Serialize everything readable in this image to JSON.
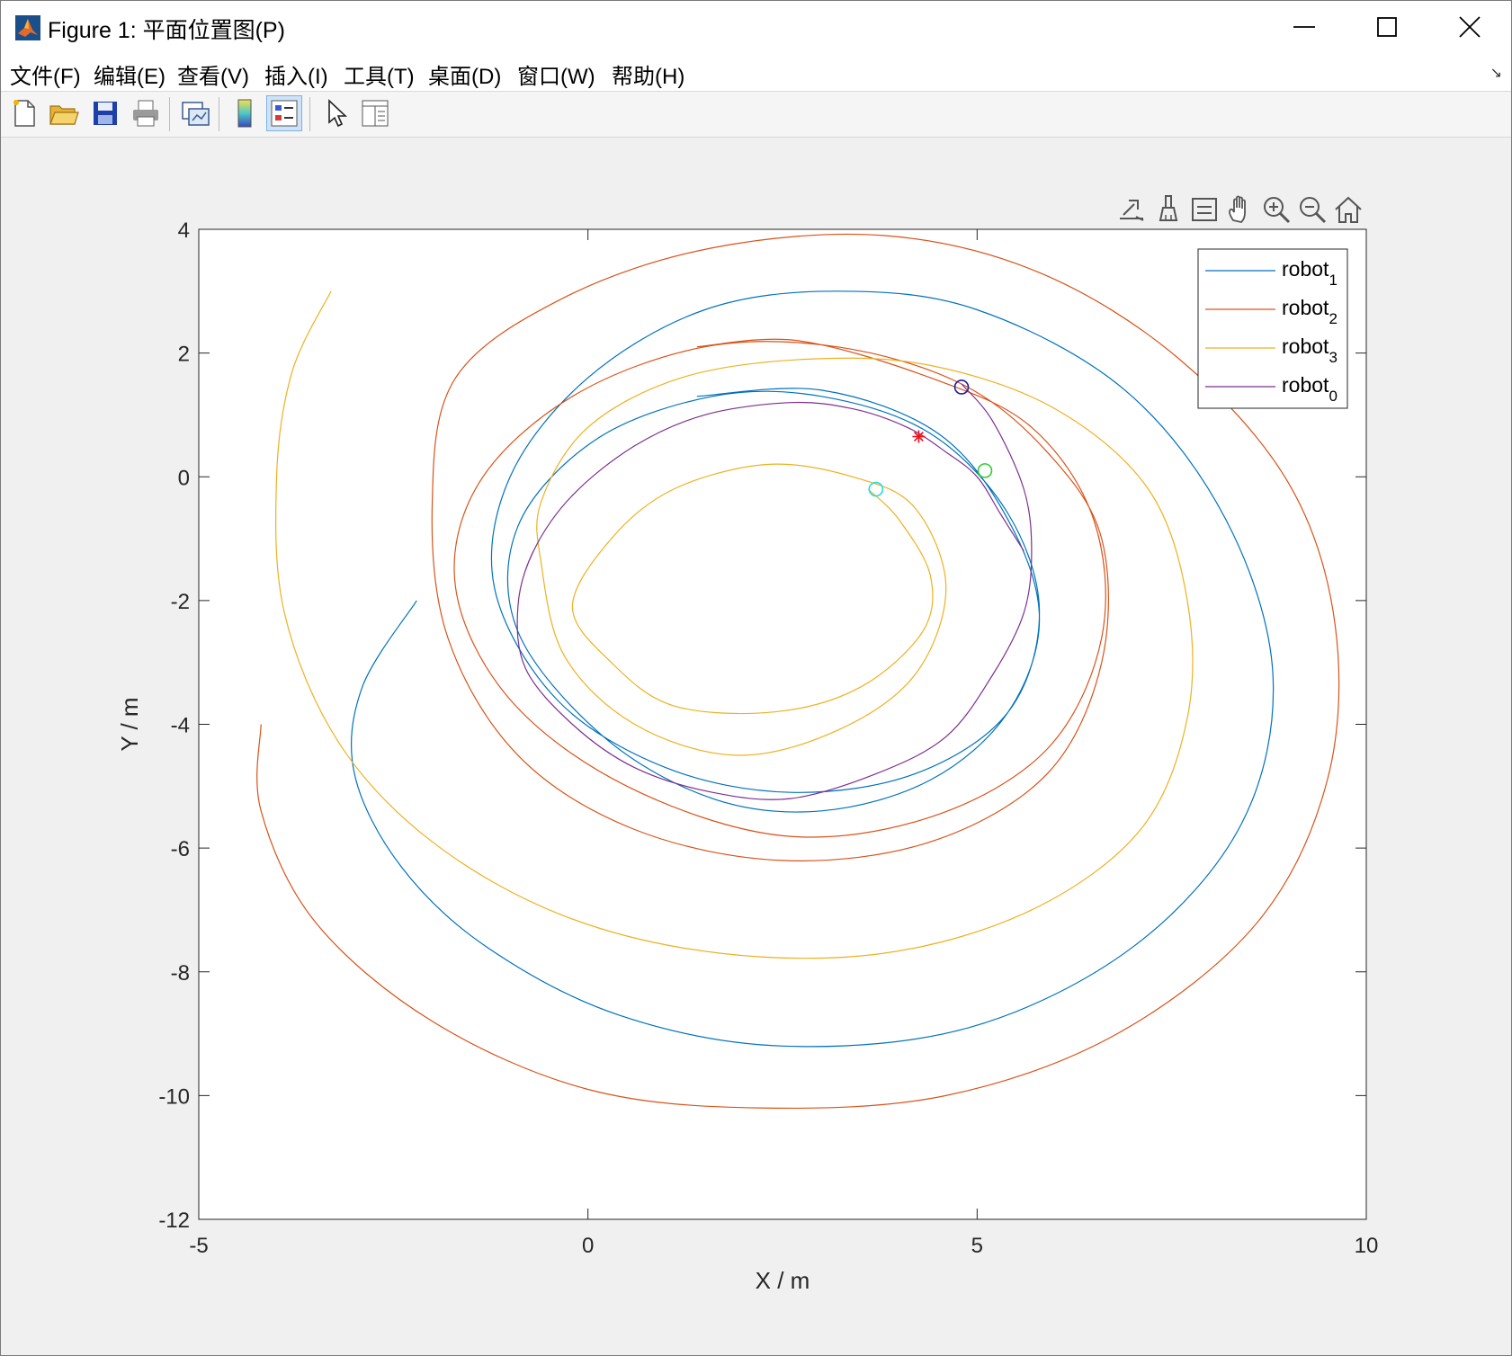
{
  "window": {
    "title": "Figure 1: 平面位置图(P)"
  },
  "menu": {
    "items": [
      {
        "label": "文件(F)"
      },
      {
        "label": "编辑(E)"
      },
      {
        "label": "查看(V)"
      },
      {
        "label": "插入(I)"
      },
      {
        "label": "工具(T)"
      },
      {
        "label": "桌面(D)"
      },
      {
        "label": "窗口(W)"
      },
      {
        "label": "帮助(H)"
      }
    ]
  },
  "toolbar": {
    "buttons": [
      "new-figure-icon",
      "open-file-icon",
      "save-icon",
      "print-icon",
      "link-plot-icon",
      "insert-colorbar-icon",
      "insert-legend-icon",
      "edit-plot-icon",
      "property-inspector-icon"
    ],
    "active": "insert-legend-icon"
  },
  "axes_toolbar": {
    "buttons": [
      "export-icon",
      "brush-icon",
      "data-tips-icon",
      "pan-icon",
      "zoom-in-icon",
      "zoom-out-icon",
      "restore-view-icon"
    ]
  },
  "chart_data": {
    "type": "line",
    "xlabel": "X / m",
    "ylabel": "Y / m",
    "xlim": [
      -5,
      10
    ],
    "ylim": [
      -12,
      4
    ],
    "xticks": [
      -5,
      0,
      5,
      10
    ],
    "yticks": [
      4,
      2,
      0,
      -2,
      -4,
      -6,
      -8,
      -10,
      -12
    ],
    "grid": false,
    "legend_position": "top-right",
    "series": [
      {
        "name": "robot",
        "subscript": "1",
        "color": "#0072BD",
        "points": [
          [
            -2.2,
            -2.0
          ],
          [
            -2.9,
            -3.4
          ],
          [
            -3.0,
            -4.8
          ],
          [
            -2.4,
            -6.3
          ],
          [
            -1.3,
            -7.6
          ],
          [
            0.4,
            -8.7
          ],
          [
            2.5,
            -9.2
          ],
          [
            4.9,
            -8.9
          ],
          [
            7.0,
            -7.6
          ],
          [
            8.4,
            -5.6
          ],
          [
            8.8,
            -3.2
          ],
          [
            8.2,
            -0.7
          ],
          [
            6.9,
            1.4
          ],
          [
            5.0,
            2.7
          ],
          [
            3.2,
            3.0
          ],
          [
            1.5,
            2.7
          ],
          [
            0.0,
            1.6
          ],
          [
            -1.0,
            0.0
          ],
          [
            -1.2,
            -1.8
          ],
          [
            -0.4,
            -3.6
          ],
          [
            1.0,
            -4.7
          ],
          [
            2.6,
            -5.1
          ],
          [
            4.2,
            -4.8
          ],
          [
            5.4,
            -3.8
          ],
          [
            5.8,
            -2.2
          ],
          [
            5.4,
            -0.6
          ],
          [
            4.4,
            0.7
          ],
          [
            3.0,
            1.3
          ],
          [
            1.6,
            1.3
          ],
          [
            0.1,
            0.6
          ],
          [
            -0.9,
            -0.8
          ],
          [
            -0.9,
            -2.5
          ],
          [
            0.2,
            -4.2
          ],
          [
            1.6,
            -5.2
          ],
          [
            3.0,
            -5.4
          ],
          [
            4.4,
            -4.9
          ],
          [
            5.4,
            -3.8
          ],
          [
            5.8,
            -2.3
          ],
          [
            5.4,
            -0.7
          ],
          [
            4.5,
            0.7
          ],
          [
            3.0,
            1.4
          ],
          [
            1.4,
            1.3
          ]
        ]
      },
      {
        "name": "robot",
        "subscript": "2",
        "color": "#D95319",
        "points": [
          [
            -4.2,
            -4.0
          ],
          [
            -4.2,
            -5.4
          ],
          [
            -3.5,
            -7.2
          ],
          [
            -2.0,
            -8.8
          ],
          [
            0.0,
            -9.9
          ],
          [
            2.2,
            -10.2
          ],
          [
            4.6,
            -10.0
          ],
          [
            6.8,
            -9.0
          ],
          [
            8.6,
            -7.2
          ],
          [
            9.5,
            -4.9
          ],
          [
            9.6,
            -2.4
          ],
          [
            9.0,
            -0.1
          ],
          [
            7.6,
            1.9
          ],
          [
            5.8,
            3.3
          ],
          [
            3.8,
            3.9
          ],
          [
            1.6,
            3.7
          ],
          [
            -0.3,
            2.9
          ],
          [
            -1.7,
            1.6
          ],
          [
            -2.0,
            -0.4
          ],
          [
            -1.8,
            -2.6
          ],
          [
            -0.9,
            -4.5
          ],
          [
            0.6,
            -5.7
          ],
          [
            2.5,
            -6.2
          ],
          [
            4.4,
            -5.9
          ],
          [
            5.9,
            -4.8
          ],
          [
            6.6,
            -3.0
          ],
          [
            6.6,
            -1.0
          ],
          [
            5.9,
            0.4
          ],
          [
            4.8,
            1.5
          ],
          [
            3.2,
            2.1
          ],
          [
            1.5,
            2.1
          ],
          [
            -0.2,
            1.3
          ],
          [
            -1.4,
            -0.1
          ],
          [
            -1.7,
            -1.8
          ],
          [
            -1.0,
            -3.6
          ],
          [
            0.5,
            -5.0
          ],
          [
            2.5,
            -5.8
          ],
          [
            4.4,
            -5.5
          ],
          [
            5.9,
            -4.4
          ],
          [
            6.6,
            -2.6
          ],
          [
            6.5,
            -0.7
          ],
          [
            5.7,
            0.8
          ],
          [
            4.4,
            1.6
          ],
          [
            2.7,
            2.2
          ],
          [
            1.4,
            2.1
          ]
        ]
      },
      {
        "name": "robot",
        "subscript": "3",
        "color": "#EDB120",
        "points": [
          [
            -3.3,
            3.0
          ],
          [
            -3.8,
            1.7
          ],
          [
            -4.0,
            0.0
          ],
          [
            -3.9,
            -2.2
          ],
          [
            -3.2,
            -4.3
          ],
          [
            -2.0,
            -5.9
          ],
          [
            -0.3,
            -7.1
          ],
          [
            1.7,
            -7.7
          ],
          [
            3.8,
            -7.7
          ],
          [
            5.7,
            -7.0
          ],
          [
            7.1,
            -5.7
          ],
          [
            7.7,
            -3.9
          ],
          [
            7.7,
            -2.0
          ],
          [
            7.2,
            -0.2
          ],
          [
            6.0,
            1.1
          ],
          [
            4.4,
            1.8
          ],
          [
            2.8,
            1.9
          ],
          [
            1.2,
            1.6
          ],
          [
            0.0,
            0.8
          ],
          [
            -0.6,
            -0.4
          ],
          [
            -0.6,
            -1.4
          ],
          [
            -0.3,
            -2.9
          ],
          [
            0.6,
            -4.0
          ],
          [
            1.9,
            -4.5
          ],
          [
            3.2,
            -4.1
          ],
          [
            4.2,
            -3.2
          ],
          [
            4.6,
            -1.8
          ],
          [
            4.2,
            -0.5
          ],
          [
            3.4,
            0.0
          ],
          [
            2.3,
            0.2
          ],
          [
            1.1,
            -0.2
          ],
          [
            0.3,
            -1.0
          ],
          [
            -0.2,
            -2.1
          ],
          [
            0.3,
            -3.0
          ],
          [
            1.1,
            -3.7
          ],
          [
            2.4,
            -3.8
          ],
          [
            3.5,
            -3.4
          ],
          [
            4.3,
            -2.5
          ],
          [
            4.4,
            -1.6
          ],
          [
            4.0,
            -0.7
          ],
          [
            3.6,
            -0.2
          ]
        ]
      },
      {
        "name": "robot",
        "subscript": "0",
        "color": "#7E2F8E",
        "points": [
          [
            4.8,
            1.5
          ],
          [
            5.2,
            0.9
          ],
          [
            5.6,
            -0.2
          ],
          [
            5.7,
            -1.2
          ],
          [
            5.6,
            -2.2
          ],
          [
            5.2,
            -3.2
          ],
          [
            4.6,
            -4.2
          ],
          [
            3.7,
            -4.8
          ],
          [
            2.6,
            -5.2
          ],
          [
            1.6,
            -5.1
          ],
          [
            0.6,
            -4.7
          ],
          [
            -0.2,
            -4.0
          ],
          [
            -0.8,
            -3.1
          ],
          [
            -0.9,
            -2.1
          ],
          [
            -0.7,
            -1.2
          ],
          [
            -0.2,
            -0.3
          ],
          [
            0.6,
            0.5
          ],
          [
            1.5,
            1.0
          ],
          [
            2.6,
            1.2
          ],
          [
            3.4,
            1.1
          ],
          [
            4.1,
            0.8
          ],
          [
            4.6,
            0.4
          ],
          [
            5.0,
            0.0
          ],
          [
            5.3,
            -0.6
          ],
          [
            5.6,
            -1.2
          ]
        ]
      }
    ],
    "markers": [
      {
        "name": "robot0 position",
        "type": "circle",
        "x": 4.8,
        "y": 1.45,
        "color": "#1a1aa6"
      },
      {
        "name": "robot1 position",
        "type": "circle",
        "x": 5.1,
        "y": 0.1,
        "color": "#33cc33"
      },
      {
        "name": "robot3 position",
        "type": "circle",
        "x": 3.7,
        "y": -0.2,
        "color": "#22dddd"
      },
      {
        "name": "target",
        "type": "asterisk",
        "x": 4.25,
        "y": 0.65,
        "color": "#e8111e"
      }
    ]
  }
}
